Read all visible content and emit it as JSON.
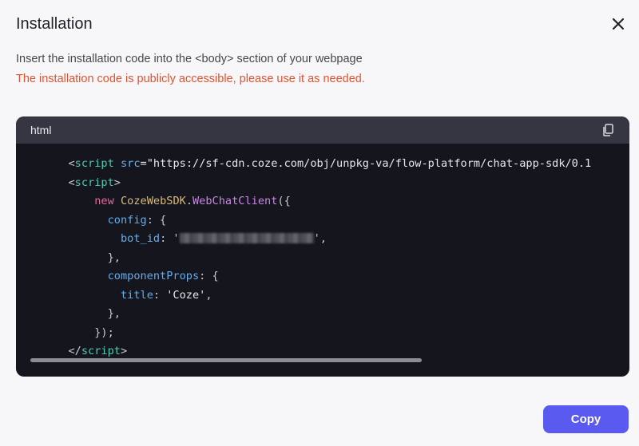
{
  "dialog": {
    "title": "Installation",
    "description": "Insert the installation code into the <body> section of your webpage",
    "warning": "The installation code is publicly accessible, please use it as needed.",
    "copy_label": "Copy"
  },
  "code": {
    "language": "html",
    "line1_open": "<",
    "line1_tag": "script",
    "line1_attr": "src",
    "line1_rest": "=\"https://sf-cdn.coze.com/obj/unpkg-va/flow-platform/chat-app-sdk/0.1",
    "line2_open": "<",
    "line2_tag": "script",
    "line2_close": ">",
    "line3_new": "new",
    "line3_cls": "CozeWebSDK",
    "line3_dot": ".",
    "line3_fn": "WebChatClient",
    "line3_rest": "({",
    "line4_prop": "config",
    "line4_rest": ": {",
    "line5_prop": "bot_id",
    "line5_rest1": ": '",
    "line5_rest2": "',",
    "line6": "},",
    "line7_prop": "componentProps",
    "line7_rest": ": {",
    "line8_prop": "title",
    "line8_rest1": ": ",
    "line8_val": "'Coze'",
    "line8_rest2": ",",
    "line9": "},",
    "line10": "});",
    "line11_open": "</",
    "line11_tag": "script",
    "line11_close": ">"
  },
  "icons": {
    "close": "close-icon",
    "copy": "copy-icon"
  },
  "colors": {
    "accent": "#5a59f0",
    "warning": "#e5512c",
    "code_bg": "#15151d",
    "code_header": "#363642"
  }
}
